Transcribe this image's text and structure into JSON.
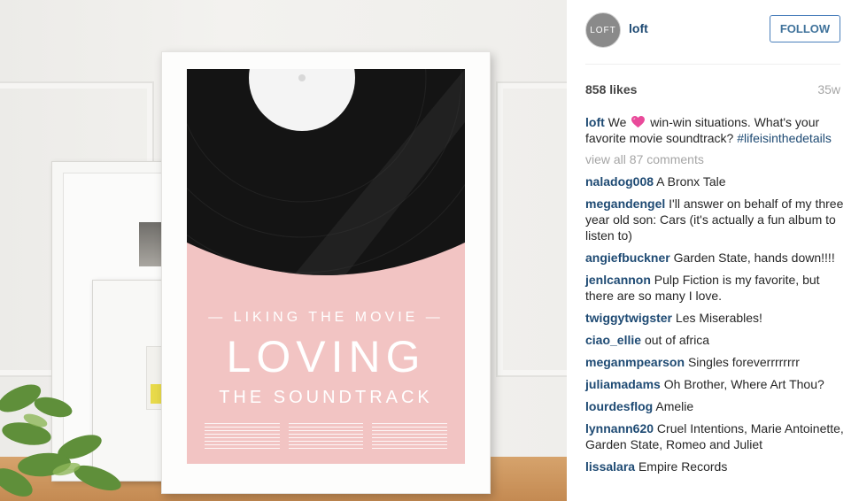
{
  "poster": {
    "line1": "— LIKING THE MOVIE —",
    "line2": "LOVING",
    "line3": "THE SOUNDTRACK"
  },
  "post": {
    "avatar_text": "LOFT",
    "username": "loft",
    "follow_label": "FOLLOW",
    "likes": "858 likes",
    "age": "35w",
    "caption_user": "loft",
    "caption_before": "We",
    "caption_after": "win-win situations. What's your favorite movie soundtrack?",
    "hashtag": "#lifeisinthedetails",
    "view_all": "view all 87 comments"
  },
  "comments": [
    {
      "user": "naladog008",
      "text": "A Bronx Tale"
    },
    {
      "user": "megandengel",
      "text": "I'll answer on behalf of my three year old son: Cars (it's actually a fun album to listen to)"
    },
    {
      "user": "angiefbuckner",
      "text": "Garden State, hands down!!!!"
    },
    {
      "user": "jenlcannon",
      "text": "Pulp Fiction is my favorite, but there are so many I love."
    },
    {
      "user": "twiggytwigster",
      "text": "Les Miserables!"
    },
    {
      "user": "ciao_ellie",
      "text": "out of africa"
    },
    {
      "user": "meganmpearson",
      "text": "Singles foreverrrrrrrr"
    },
    {
      "user": "juliamadams",
      "text": "Oh Brother, Where Art Thou?"
    },
    {
      "user": "lourdesflog",
      "text": "Amelie"
    },
    {
      "user": "lynnann620",
      "text": "Cruel Intentions, Marie Antoinette, Garden State, Romeo and Juliet"
    },
    {
      "user": "lissalara",
      "text": "Empire Records"
    }
  ],
  "colors": {
    "username_blue": "#1e4a73",
    "follow_border": "#4a7fbb",
    "muted_gray": "#a5a5a5",
    "poster_pink": "#f2c4c3",
    "heart_pink": "#e94a9a"
  },
  "icons": [
    "heart-emoji-icon"
  ]
}
